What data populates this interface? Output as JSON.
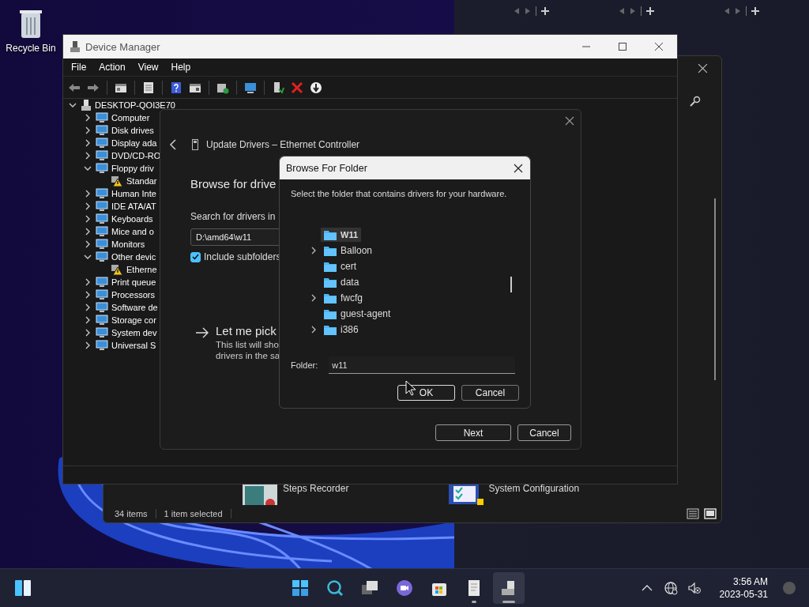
{
  "desktop": {
    "icons": [
      {
        "label": "Recycle Bin"
      }
    ]
  },
  "background_window": {
    "items": [
      {
        "label": "Steps Recorder"
      },
      {
        "label": "System Configuration"
      }
    ],
    "status_bar": [
      "34 items",
      "1 item selected"
    ]
  },
  "device_manager": {
    "title": "Device Manager",
    "menu": [
      "File",
      "Action",
      "View",
      "Help"
    ],
    "tree": {
      "label": "DESKTOP-QOI3E70",
      "expanded": true,
      "children": [
        {
          "label": "Computer",
          "expanded": false
        },
        {
          "label": "Disk drives",
          "expanded": false
        },
        {
          "label": "Display ada",
          "expanded": false
        },
        {
          "label": "DVD/CD-RO",
          "expanded": false
        },
        {
          "label": "Floppy driv",
          "expanded": true,
          "children": [
            {
              "label": "Standar",
              "warning": true
            }
          ]
        },
        {
          "label": "Human Inte",
          "expanded": false
        },
        {
          "label": "IDE ATA/AT",
          "expanded": false
        },
        {
          "label": "Keyboards",
          "expanded": false
        },
        {
          "label": "Mice and o",
          "expanded": false
        },
        {
          "label": "Monitors",
          "expanded": false
        },
        {
          "label": "Other devic",
          "expanded": true,
          "children": [
            {
              "label": "Etherne",
              "warning": true
            }
          ]
        },
        {
          "label": "Print queue",
          "expanded": false
        },
        {
          "label": "Processors",
          "expanded": false
        },
        {
          "label": "Software de",
          "expanded": false
        },
        {
          "label": "Storage cor",
          "expanded": false
        },
        {
          "label": "System dev",
          "expanded": false
        },
        {
          "label": "Universal S",
          "expanded": false
        }
      ]
    }
  },
  "update_dialog": {
    "title": "Update Drivers – Ethernet Controller",
    "heading": "Browse for drive",
    "search_label": "Search for drivers in",
    "path_field": {
      "value": "D:\\amd64\\w11"
    },
    "include_subfolders": {
      "label": "Include subfolders",
      "checked": true
    },
    "pick_option": {
      "title": "Let me pick",
      "description_lines": [
        "This list will sho",
        "drivers in the sa"
      ]
    },
    "buttons": [
      "Next",
      "Cancel"
    ]
  },
  "browse_dialog": {
    "title": "Browse For Folder",
    "instruction": "Select the folder that contains drivers for your hardware.",
    "folders": [
      {
        "name": "W11",
        "selected": true,
        "expandable": false
      },
      {
        "name": "Balloon",
        "selected": false,
        "expandable": true
      },
      {
        "name": "cert",
        "selected": false,
        "expandable": false
      },
      {
        "name": "data",
        "selected": false,
        "expandable": false
      },
      {
        "name": "fwcfg",
        "selected": false,
        "expandable": true
      },
      {
        "name": "guest-agent",
        "selected": false,
        "expandable": false
      },
      {
        "name": "i386",
        "selected": false,
        "expandable": true
      }
    ],
    "folder_field": {
      "label": "Folder:",
      "value": "w11"
    },
    "buttons": [
      {
        "label": "OK",
        "focused": true
      },
      {
        "label": "Cancel",
        "focused": false
      }
    ]
  },
  "taskbar": {
    "apps": [
      {
        "kind": "start",
        "running": false,
        "active": false
      },
      {
        "kind": "search",
        "running": false,
        "active": false
      },
      {
        "kind": "taskview",
        "running": false,
        "active": false
      },
      {
        "kind": "chat",
        "running": false,
        "active": false
      },
      {
        "kind": "store",
        "running": false,
        "active": false
      },
      {
        "kind": "notepad",
        "running": true,
        "active": false
      },
      {
        "kind": "devmgr",
        "running": true,
        "active": true
      }
    ],
    "clock": {
      "time": "3:56 AM",
      "date": "2023-05-31"
    }
  }
}
